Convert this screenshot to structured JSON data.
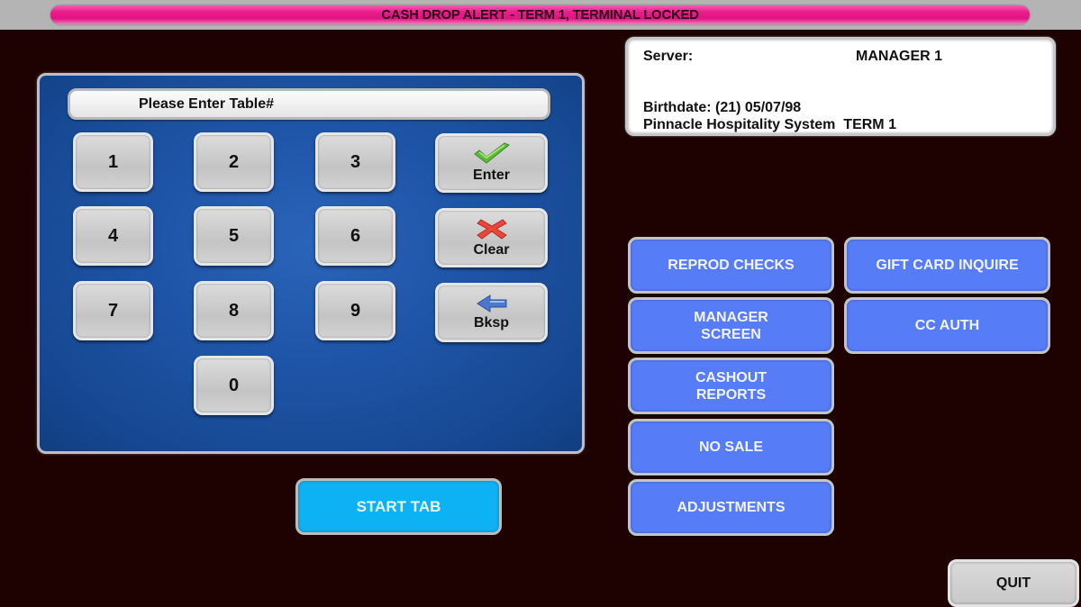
{
  "alert": {
    "text": "CASH DROP ALERT - TERM 1, TERMINAL LOCKED",
    "color": "#ec1c8c"
  },
  "info": {
    "server_label": "Server:",
    "server_value": "MANAGER 1",
    "birthdate": "Birthdate: (21) 05/07/98",
    "system": "Pinnacle Hospitality System  TERM 1"
  },
  "keypad": {
    "prompt": "Please Enter Table#",
    "digits": [
      "1",
      "2",
      "3",
      "4",
      "5",
      "6",
      "7",
      "8",
      "9",
      "0"
    ],
    "enter_label": "Enter",
    "clear_label": "Clear",
    "bksp_label": "Bksp",
    "icons": {
      "enter": "checkmark-icon",
      "clear": "x-icon",
      "bksp": "arrow-left-icon"
    }
  },
  "start_tab_label": "START TAB",
  "manager_buttons": {
    "reprod_checks": "REPROD CHECKS",
    "gift_card_inquire": "GIFT CARD INQUIRE",
    "manager_screen": "MANAGER\nSCREEN",
    "cc_auth": "CC AUTH",
    "cashout_reports": "CASHOUT\nREPORTS",
    "no_sale": "NO SALE",
    "adjustments": "ADJUSTMENTS"
  },
  "quit_label": "QUIT",
  "colors": {
    "background": "#1e0202",
    "manager_button": "#577cf8",
    "start_tab": "#0db2f5",
    "keypad_panel": "#1f55a8"
  }
}
